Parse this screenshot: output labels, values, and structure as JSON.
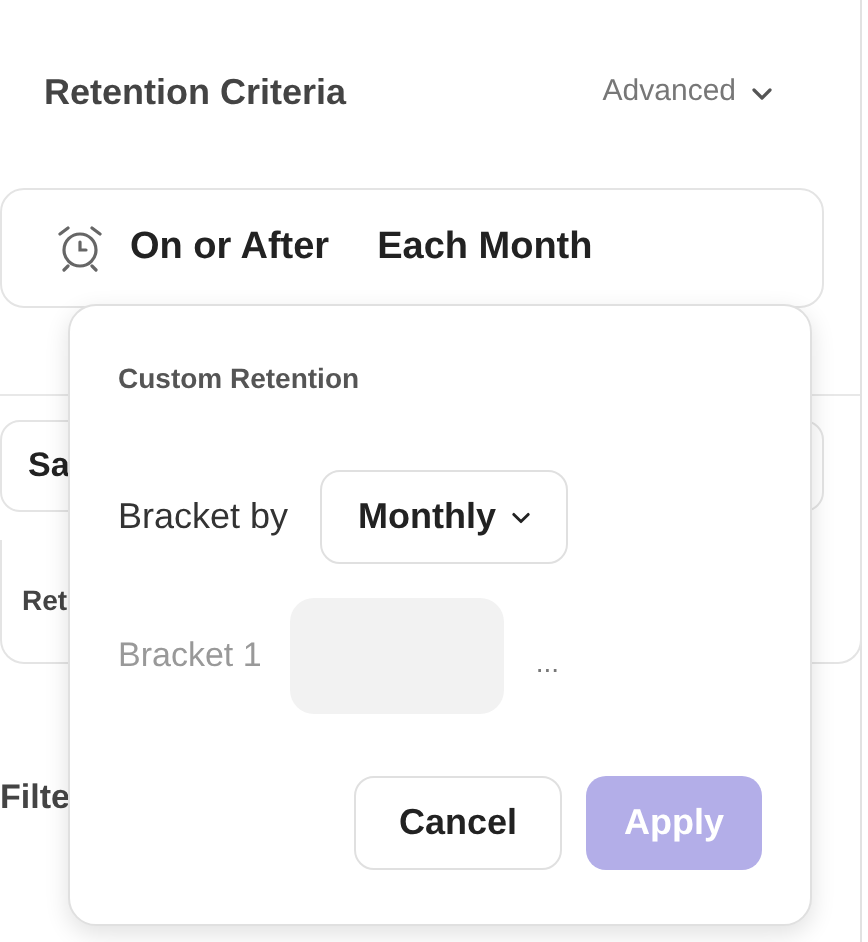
{
  "header": {
    "title": "Retention Criteria",
    "menu": "Advanced"
  },
  "criteria": {
    "condition": "On or After",
    "period": "Each Month"
  },
  "background_fields": [
    "Sa",
    "Ret",
    "Filte"
  ],
  "popover": {
    "title": "Custom Retention",
    "bracket_by_label": "Bracket by",
    "bracket_by_value": "Monthly",
    "brackets": [
      {
        "label": "Bracket 1",
        "more": "..."
      }
    ],
    "buttons": [
      {
        "label": "Cancel",
        "kind": "secondary",
        "disabled": false
      },
      {
        "label": "Apply",
        "kind": "primary",
        "disabled": true
      }
    ]
  }
}
